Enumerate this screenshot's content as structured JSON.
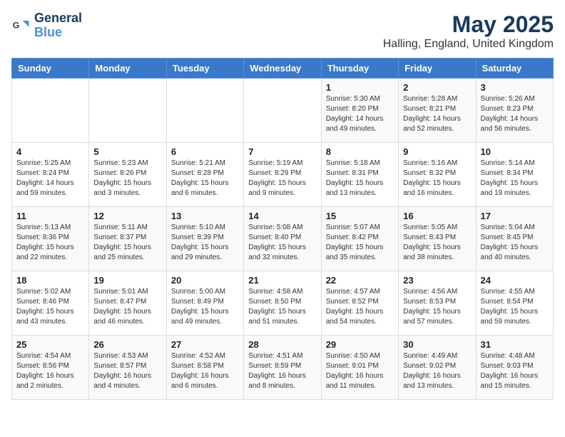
{
  "header": {
    "logo_line1": "General",
    "logo_line2": "Blue",
    "month": "May 2025",
    "location": "Halling, England, United Kingdom"
  },
  "weekdays": [
    "Sunday",
    "Monday",
    "Tuesday",
    "Wednesday",
    "Thursday",
    "Friday",
    "Saturday"
  ],
  "weeks": [
    [
      {
        "day": "",
        "info": ""
      },
      {
        "day": "",
        "info": ""
      },
      {
        "day": "",
        "info": ""
      },
      {
        "day": "",
        "info": ""
      },
      {
        "day": "1",
        "info": "Sunrise: 5:30 AM\nSunset: 8:20 PM\nDaylight: 14 hours\nand 49 minutes."
      },
      {
        "day": "2",
        "info": "Sunrise: 5:28 AM\nSunset: 8:21 PM\nDaylight: 14 hours\nand 52 minutes."
      },
      {
        "day": "3",
        "info": "Sunrise: 5:26 AM\nSunset: 8:23 PM\nDaylight: 14 hours\nand 56 minutes."
      }
    ],
    [
      {
        "day": "4",
        "info": "Sunrise: 5:25 AM\nSunset: 8:24 PM\nDaylight: 14 hours\nand 59 minutes."
      },
      {
        "day": "5",
        "info": "Sunrise: 5:23 AM\nSunset: 8:26 PM\nDaylight: 15 hours\nand 3 minutes."
      },
      {
        "day": "6",
        "info": "Sunrise: 5:21 AM\nSunset: 8:28 PM\nDaylight: 15 hours\nand 6 minutes."
      },
      {
        "day": "7",
        "info": "Sunrise: 5:19 AM\nSunset: 8:29 PM\nDaylight: 15 hours\nand 9 minutes."
      },
      {
        "day": "8",
        "info": "Sunrise: 5:18 AM\nSunset: 8:31 PM\nDaylight: 15 hours\nand 13 minutes."
      },
      {
        "day": "9",
        "info": "Sunrise: 5:16 AM\nSunset: 8:32 PM\nDaylight: 15 hours\nand 16 minutes."
      },
      {
        "day": "10",
        "info": "Sunrise: 5:14 AM\nSunset: 8:34 PM\nDaylight: 15 hours\nand 19 minutes."
      }
    ],
    [
      {
        "day": "11",
        "info": "Sunrise: 5:13 AM\nSunset: 8:36 PM\nDaylight: 15 hours\nand 22 minutes."
      },
      {
        "day": "12",
        "info": "Sunrise: 5:11 AM\nSunset: 8:37 PM\nDaylight: 15 hours\nand 25 minutes."
      },
      {
        "day": "13",
        "info": "Sunrise: 5:10 AM\nSunset: 8:39 PM\nDaylight: 15 hours\nand 29 minutes."
      },
      {
        "day": "14",
        "info": "Sunrise: 5:08 AM\nSunset: 8:40 PM\nDaylight: 15 hours\nand 32 minutes."
      },
      {
        "day": "15",
        "info": "Sunrise: 5:07 AM\nSunset: 8:42 PM\nDaylight: 15 hours\nand 35 minutes."
      },
      {
        "day": "16",
        "info": "Sunrise: 5:05 AM\nSunset: 8:43 PM\nDaylight: 15 hours\nand 38 minutes."
      },
      {
        "day": "17",
        "info": "Sunrise: 5:04 AM\nSunset: 8:45 PM\nDaylight: 15 hours\nand 40 minutes."
      }
    ],
    [
      {
        "day": "18",
        "info": "Sunrise: 5:02 AM\nSunset: 8:46 PM\nDaylight: 15 hours\nand 43 minutes."
      },
      {
        "day": "19",
        "info": "Sunrise: 5:01 AM\nSunset: 8:47 PM\nDaylight: 15 hours\nand 46 minutes."
      },
      {
        "day": "20",
        "info": "Sunrise: 5:00 AM\nSunset: 8:49 PM\nDaylight: 15 hours\nand 49 minutes."
      },
      {
        "day": "21",
        "info": "Sunrise: 4:58 AM\nSunset: 8:50 PM\nDaylight: 15 hours\nand 51 minutes."
      },
      {
        "day": "22",
        "info": "Sunrise: 4:57 AM\nSunset: 8:52 PM\nDaylight: 15 hours\nand 54 minutes."
      },
      {
        "day": "23",
        "info": "Sunrise: 4:56 AM\nSunset: 8:53 PM\nDaylight: 15 hours\nand 57 minutes."
      },
      {
        "day": "24",
        "info": "Sunrise: 4:55 AM\nSunset: 8:54 PM\nDaylight: 15 hours\nand 59 minutes."
      }
    ],
    [
      {
        "day": "25",
        "info": "Sunrise: 4:54 AM\nSunset: 8:56 PM\nDaylight: 16 hours\nand 2 minutes."
      },
      {
        "day": "26",
        "info": "Sunrise: 4:53 AM\nSunset: 8:57 PM\nDaylight: 16 hours\nand 4 minutes."
      },
      {
        "day": "27",
        "info": "Sunrise: 4:52 AM\nSunset: 8:58 PM\nDaylight: 16 hours\nand 6 minutes."
      },
      {
        "day": "28",
        "info": "Sunrise: 4:51 AM\nSunset: 8:59 PM\nDaylight: 16 hours\nand 8 minutes."
      },
      {
        "day": "29",
        "info": "Sunrise: 4:50 AM\nSunset: 9:01 PM\nDaylight: 16 hours\nand 11 minutes."
      },
      {
        "day": "30",
        "info": "Sunrise: 4:49 AM\nSunset: 9:02 PM\nDaylight: 16 hours\nand 13 minutes."
      },
      {
        "day": "31",
        "info": "Sunrise: 4:48 AM\nSunset: 9:03 PM\nDaylight: 16 hours\nand 15 minutes."
      }
    ]
  ]
}
